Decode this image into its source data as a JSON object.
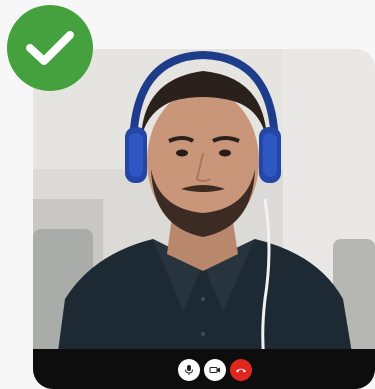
{
  "status": {
    "verified": true,
    "icon": "check-icon",
    "color": "#45a13e"
  },
  "video_call": {
    "participant_feed": "man-with-headphones",
    "controls": [
      {
        "name": "mic-button",
        "icon": "microphone-icon",
        "color": "#ffffff"
      },
      {
        "name": "camera-button",
        "icon": "video-camera-icon",
        "color": "#ffffff"
      },
      {
        "name": "end-call-button",
        "icon": "phone-hangup-icon",
        "color": "#e0271f"
      }
    ]
  }
}
